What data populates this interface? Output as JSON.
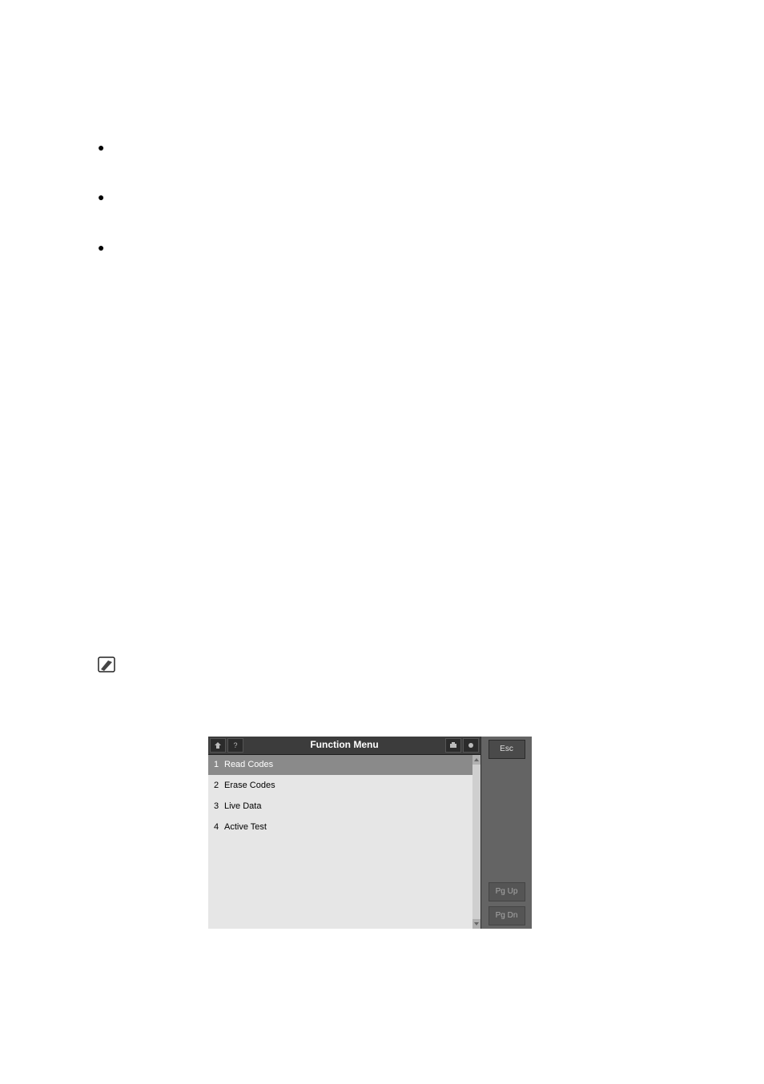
{
  "bullets": [
    "",
    "",
    ""
  ],
  "note": "",
  "screenshot": {
    "title": "Function Menu",
    "rows": [
      {
        "num": "1",
        "label": "Read Codes",
        "selected": true
      },
      {
        "num": "2",
        "label": "Erase Codes",
        "selected": false
      },
      {
        "num": "3",
        "label": "Live Data",
        "selected": false
      },
      {
        "num": "4",
        "label": "Active Test",
        "selected": false
      }
    ],
    "buttons": {
      "esc": "Esc",
      "pgup": "Pg Up",
      "pgdn": "Pg Dn"
    }
  }
}
